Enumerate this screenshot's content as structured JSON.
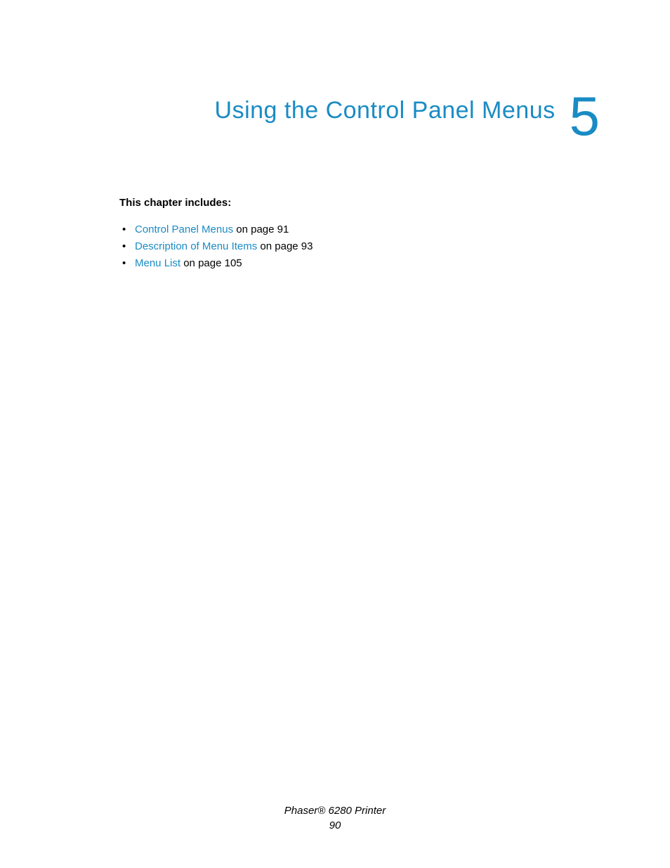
{
  "header": {
    "chapter_title": "Using the Control Panel Menus",
    "chapter_number": "5"
  },
  "intro": "This chapter includes:",
  "toc": [
    {
      "link_text": "Control Panel Menus",
      "suffix": " on page 91"
    },
    {
      "link_text": "Description of Menu Items",
      "suffix": " on page 93"
    },
    {
      "link_text": "Menu List",
      "suffix": " on page 105"
    }
  ],
  "footer": {
    "product": "Phaser® 6280 Printer",
    "page_number": "90"
  }
}
